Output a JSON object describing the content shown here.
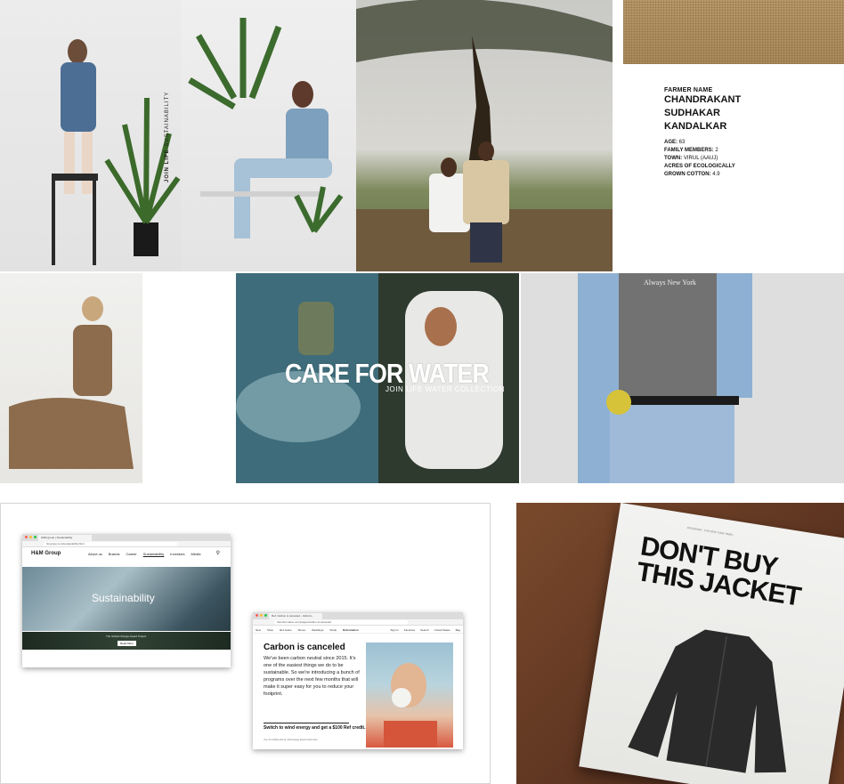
{
  "panel1": {
    "caption_bold": "JOIN LIFE",
    "caption_rest": " SUSTAINABILITY"
  },
  "farmer": {
    "label": "FARMER NAME",
    "name_line1": "CHANDRAKANT",
    "name_line2": "SUDHAKAR",
    "name_line3": "KANDALKAR",
    "age_label": "AGE:",
    "age": " 63",
    "family_label": "FAMILY MEMBERS:",
    "family": " 2",
    "town_label": "TOWN:",
    "town": " VIRUL (AAUJ)",
    "acres_label_1": "ACRES OF ECOLOGICALLY",
    "acres_label_2": "GROWN COTTON:",
    "acres": " 4.9"
  },
  "water": {
    "title": "CARE FOR WATER",
    "subtitle": "JOIN LIFE WATER COLLECTION"
  },
  "shirt": {
    "text": "Always New York"
  },
  "hm_browser": {
    "tab": "H&M group | Sustainability",
    "url": "hmgroup.com/sustainability.html",
    "logo": "H&M Group",
    "nav": [
      "About us",
      "Brands",
      "Career",
      "Sustainability",
      "Investors",
      "Media"
    ],
    "hero_title": "Sustainability",
    "band_text": "The Global Change Award Project",
    "band_button": "Read More"
  },
  "ref_browser": {
    "tab": "Ref: Carbon is canceled – Reform...",
    "url": "thereformation.com/pages/carbon-is-canceled",
    "nav_left": [
      "New",
      "Shop",
      "Ref Jeans",
      "Shoes",
      "Weddings",
      "Study",
      "Reformation"
    ],
    "nav_right": [
      "Sign In",
      "Favorites",
      "Search",
      "United States",
      "Bag"
    ],
    "headline": "Carbon is canceled",
    "body": "We've been carbon neutral since 2015. It's one of the easiest things we do to be sustainable. So we're introducing a bunch of programs over the next few months that will make it super easy for you to reduce your footprint.",
    "subhead": "Switch to wind energy and get a $100 Ref credit.",
    "tiny": "Yes, it's a bribe and no, wind energy doesn't cost more."
  },
  "newspaper": {
    "top_text": "PATAGONIA · THE NEW YORK TIMES",
    "headline_line1": "DON'T BUY",
    "headline_line2": "THIS JACKET"
  },
  "colors": {
    "brown_wood": "#5b3320",
    "paper": "#efefed",
    "water_teal": "#3d6a7a"
  }
}
